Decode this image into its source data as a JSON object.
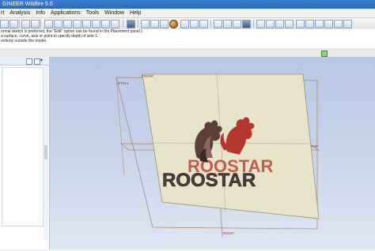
{
  "window": {
    "title": "GINEER Wildfire 5.0"
  },
  "menu": [
    "rt",
    "Analysis",
    "Info",
    "Applications",
    "Tools",
    "Window",
    "Help"
  ],
  "message_lines": [
    "ormal sketch is preferred, the \"Edit\" option can be found in the Placement panel.)",
    "a surface, curve, axis or point to specify depth of side 1.",
    "entirely outside the model."
  ],
  "model": {
    "datum_labels": {
      "front": "FRONT",
      "dtm": "DTM 1",
      "top": "TOP",
      "right": "RIGHT"
    },
    "logo_text_back": "ROOSTAR",
    "logo_text_front": "ROOSTAR"
  },
  "colors": {
    "titlebar": "#3468b8",
    "viewport_top": "#b8c7e3",
    "plane_fill": "#e8e5cc",
    "logo_red": "#b0362e",
    "logo_dark": "#6b4a42"
  },
  "icons": [
    "new-icon",
    "open-icon",
    "save-icon",
    "print-icon",
    "email-icon",
    "undo-icon",
    "redo-icon",
    "cut-icon",
    "copy-icon",
    "paste-icon",
    "regenerate-icon",
    "find-icon",
    "select-icon",
    "window-icon",
    "repaint-icon",
    "zoom-in-icon",
    "zoom-out-icon",
    "refit-icon",
    "orient-icon",
    "saved-views-icon",
    "layers-icon",
    "appearance-icon",
    "datum-planes-icon",
    "datum-axes-icon",
    "datum-points-icon",
    "csys-icon",
    "annotation-icon",
    "wireframe-icon",
    "hidden-line-icon",
    "no-hidden-icon",
    "shading-icon"
  ]
}
